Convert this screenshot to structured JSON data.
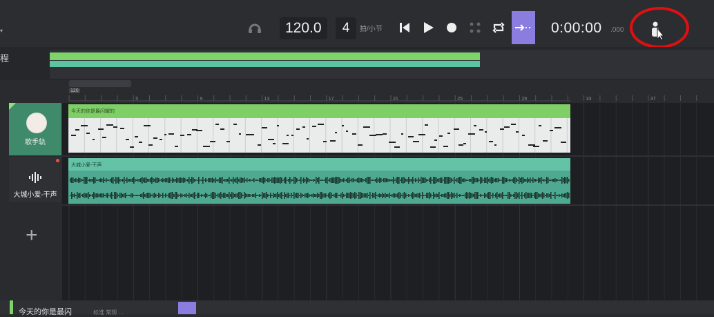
{
  "toolbar": {
    "dropdown_glyph": "▾",
    "tempo": "120.0",
    "beats_per_bar": "4",
    "beats_label": "拍/小节",
    "time": "0:00:00",
    "time_ms": ".000",
    "accent_color": "#8a7de0",
    "highlight_color": "#e01010"
  },
  "overview": {
    "label": "程"
  },
  "ruler": {
    "tempo_marker": "120",
    "bars": [
      "5",
      "9",
      "13",
      "17",
      "21",
      "25",
      "29",
      "33",
      "37"
    ]
  },
  "tracks": [
    {
      "name": "歌手轨",
      "type": "vocal",
      "color": "#7fcf67"
    },
    {
      "name": "大城小爱-干声",
      "type": "audio",
      "color": "#64c2a6"
    }
  ],
  "clips": {
    "vocal_title": "今天的你是最闪耀的",
    "audio_title": "大城小爱-干声"
  },
  "add_track": "+",
  "bottom": {
    "label": "今天的你是最闪",
    "sub_label": "标准 常规 …"
  }
}
